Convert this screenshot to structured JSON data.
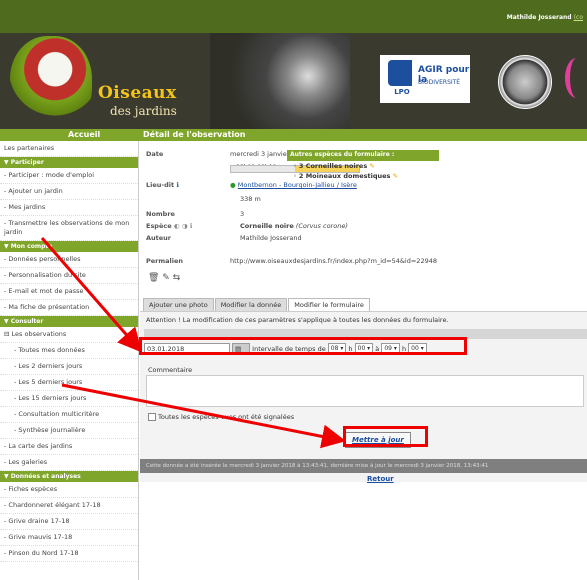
{
  "header": {
    "user": "Mathilde Josserand",
    "user_link": "(co"
  },
  "banner": {
    "logo_title": "Oiseaux",
    "logo_subtitle": "des jardins",
    "partners": [
      {
        "name": "LPO"
      },
      {
        "line1": "AGIR pour la",
        "line2": "BIODIVERSITÉ"
      }
    ]
  },
  "nav": {
    "home": "Accueil",
    "detail": "Détail de l'observation"
  },
  "sidebar": {
    "top": "Les partenaires",
    "sections": [
      {
        "title": "Participer",
        "items": [
          "- Participer : mode d'emploi",
          "- Ajouter un jardin",
          "- Mes jardins",
          "- Transmettre les observations de mon jardin"
        ]
      },
      {
        "title": "Mon compte",
        "items": [
          "- Données personnelles",
          "- Personnalisation du site",
          "- E-mail et mot de passe",
          "- Ma fiche de présentation"
        ]
      },
      {
        "title": "Consulter",
        "items": [
          "⊟ Les observations",
          "- Toutes mes données",
          "- Les 2 derniers jours",
          "- Les 5 derniers jours",
          "- Les 15 derniers jours",
          "- Consultation multicritère",
          "- Synthèse journalière",
          "- La carte des jardins",
          "- Les galeries"
        ]
      },
      {
        "title": "Données et analyses",
        "items": [
          "- Fiches espèces",
          "- Chardonneret élégant 17-18",
          "- Grive draine 17-18",
          "- Grive mauvis 17-18",
          "- Pinson du Nord 17-18"
        ]
      }
    ]
  },
  "detail": {
    "date_label": "Date",
    "date_value": "mercredi 3 janvier 2018",
    "time_value": "08h00-09h00",
    "lieu_label": "Lieu-dit",
    "lieu_value": "Montbernon - Bourgoin-Jallieu / Isère",
    "altitude": "338 m",
    "nombre_label": "Nombre",
    "nombre_value": "3",
    "espece_label": "Espèce",
    "espece_value": "Corneille noire",
    "espece_latin": "(Corvus corone)",
    "auteur_label": "Auteur",
    "auteur_value": "Mathilde Josserand",
    "permalien_label": "Permalien",
    "permalien_value": "http://www.oiseauxdesjardins.fr/index.php?m_id=54&id=22948"
  },
  "others": {
    "title": "Autres espèces du formulaire :",
    "items": [
      "3 Corneilles noires",
      "2 Moineaux domestiques"
    ]
  },
  "tabs": [
    "Ajouter une photo",
    "Modifier la donnée",
    "Modifier le formulaire"
  ],
  "form": {
    "warning": "Attention ! La modification de ces paramètres s'applique à toutes les données du formulaire.",
    "date_value": "03.01.2018",
    "interval_label": "Intervalle de temps de",
    "h1": "08",
    "m1": "00",
    "h2": "09",
    "m2": "00",
    "h_label": "h",
    "a_label": "à",
    "comment_label": "Commentaire",
    "check_label": "Toutes les espèces vues ont été signalées",
    "save_label": "Mettre à jour"
  },
  "status": "Cette donnée a été insérée le mercredi 3 janvier 2018 à 13:43:41, dernière mise à jour le mercredi 3 janvier 2018, 13:43:41",
  "retour": "Retour"
}
